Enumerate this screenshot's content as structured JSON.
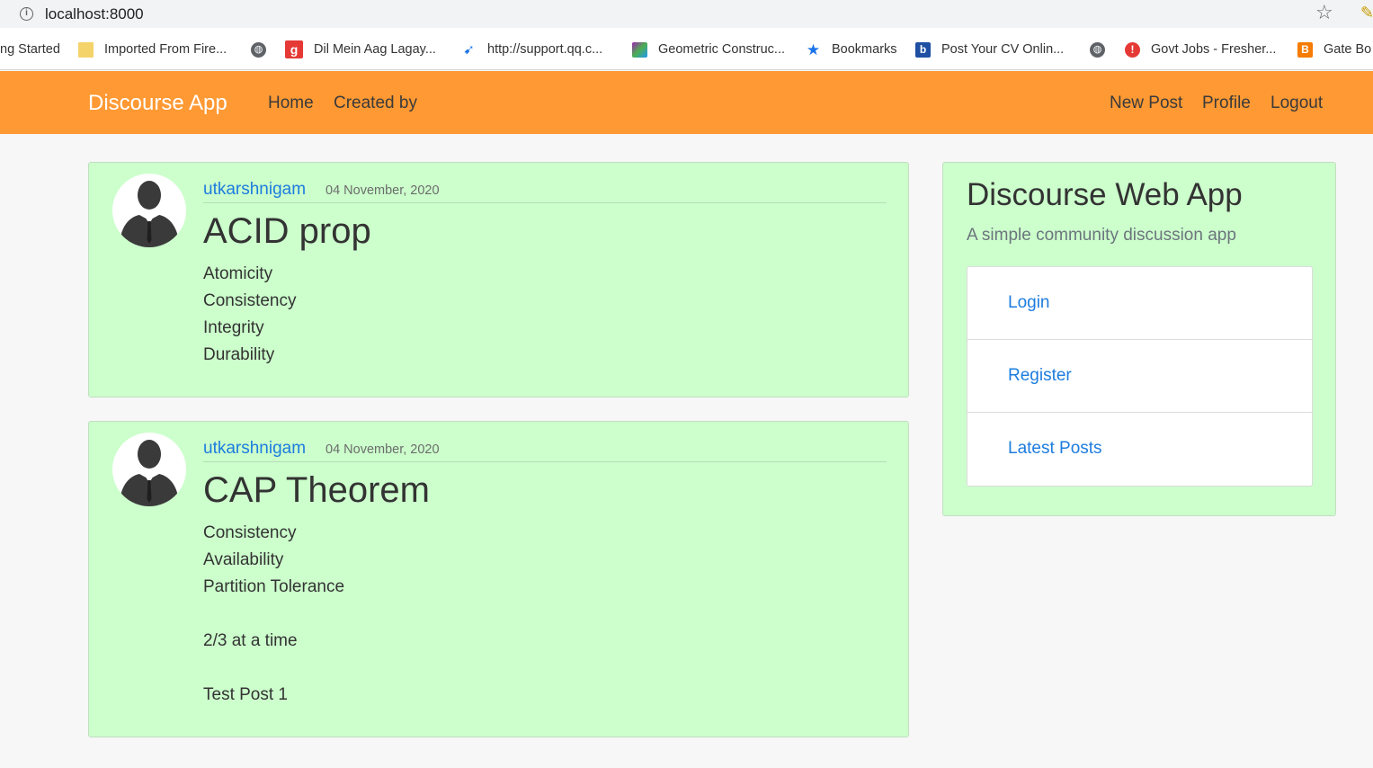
{
  "browser": {
    "url": "localhost:8000",
    "bookmarks": [
      {
        "label": "ng Started",
        "icon": "none"
      },
      {
        "label": "Imported From Fire...",
        "icon": "folder-icon"
      },
      {
        "label": "",
        "icon": "globe-icon"
      },
      {
        "label": "Dil Mein Aag Lagay...",
        "icon": "gaana-icon"
      },
      {
        "label": "http://support.qq.c...",
        "icon": "qq-icon"
      },
      {
        "label": "Geometric Construc...",
        "icon": "geometry-icon"
      },
      {
        "label": "Bookmarks",
        "icon": "star-icon"
      },
      {
        "label": "Post Your CV Onlin...",
        "icon": "cv-icon"
      },
      {
        "label": "",
        "icon": "globe-icon"
      },
      {
        "label": "Govt Jobs - Fresher...",
        "icon": "info-red-icon"
      },
      {
        "label": "Gate Bo",
        "icon": "blogger-icon"
      }
    ]
  },
  "navbar": {
    "brand": "Discourse App",
    "left_links": [
      "Home",
      "Created by"
    ],
    "right_links": [
      "New Post",
      "Profile",
      "Logout"
    ],
    "color": "#ff9933"
  },
  "posts": [
    {
      "author": "utkarshnigam",
      "date": "04 November, 2020",
      "title": "ACID prop",
      "lines": [
        "Atomicity",
        "Consistency",
        "Integrity",
        "Durability"
      ]
    },
    {
      "author": "utkarshnigam",
      "date": "04 November, 2020",
      "title": "CAP Theorem",
      "lines": [
        "Consistency",
        "Availability",
        "Partition Tolerance",
        "",
        "2/3 at a time",
        "",
        "Test Post 1"
      ]
    }
  ],
  "sidebar": {
    "title": "Discourse Web App",
    "subtitle": "A simple community discussion app",
    "links": [
      "Login",
      "Register",
      "Latest Posts"
    ]
  },
  "colors": {
    "card_bg": "#ccffcc",
    "link": "#1d7cde"
  }
}
